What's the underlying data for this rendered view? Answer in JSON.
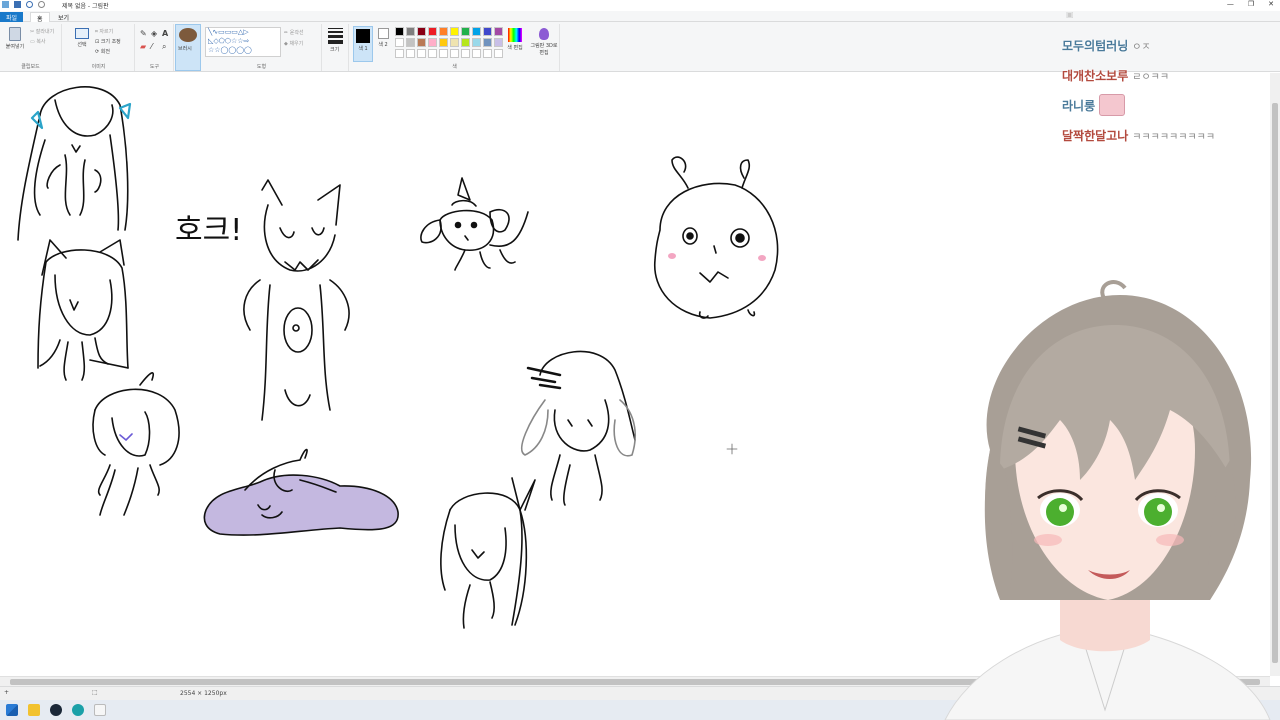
{
  "window": {
    "title": "제목 없음 - 그림판",
    "controls": [
      "—",
      "❐",
      "✕"
    ]
  },
  "ribbon_tabs": [
    "파일",
    "홈",
    "보기"
  ],
  "ribbon": {
    "clipboard": {
      "paste_label": "붙여넣기",
      "cut_label": "잘라내기",
      "copy_label": "복사",
      "group_label": "클립보드"
    },
    "image": {
      "select_label": "선택",
      "crop_label": "자르기",
      "resize_label": "크기 조정",
      "rotate_label": "회전",
      "group_label": "이미지"
    },
    "tools": {
      "group_label": "도구"
    },
    "brushes": {
      "label": "브러시"
    },
    "shapes": {
      "outline_label": "윤곽선",
      "fill_label": "채우기",
      "group_label": "도형"
    },
    "size": {
      "label": "크기"
    },
    "colors": {
      "color1_label": "색 1",
      "color2_label": "색 2",
      "edit_label": "색 편집",
      "paint3d_label": "그림판 3D로 편집",
      "group_label": "색",
      "row1": [
        "#000000",
        "#7f7f7f",
        "#880015",
        "#ed1c24",
        "#ff7f27",
        "#fff200",
        "#22b14c",
        "#00a2e8",
        "#3f48cc",
        "#a349a4"
      ],
      "row2": [
        "#ffffff",
        "#c3c3c3",
        "#b97a57",
        "#ffaec9",
        "#ffc90e",
        "#efe4b0",
        "#b5e61d",
        "#99d9ea",
        "#7092be",
        "#c8bfe7"
      ]
    }
  },
  "statusbar": {
    "dimensions": "2554 × 1250px"
  },
  "chat": [
    {
      "user": "모두의텀러닝",
      "message": "ㅇㅈ",
      "color": "#3d7fa8"
    },
    {
      "user": "대개찬소보루",
      "message": "ㄹㅇㅋㅋ",
      "color": "#c0392b"
    },
    {
      "user": "라니룽",
      "message": "",
      "color": "#3d7fa8",
      "sticker": true
    },
    {
      "user": "달짝한달고나",
      "message": "ㅋㅋㅋㅋㅋㅋㅋㅋㅋ",
      "color": "#c0392b"
    }
  ],
  "canvas_text": "호크!"
}
